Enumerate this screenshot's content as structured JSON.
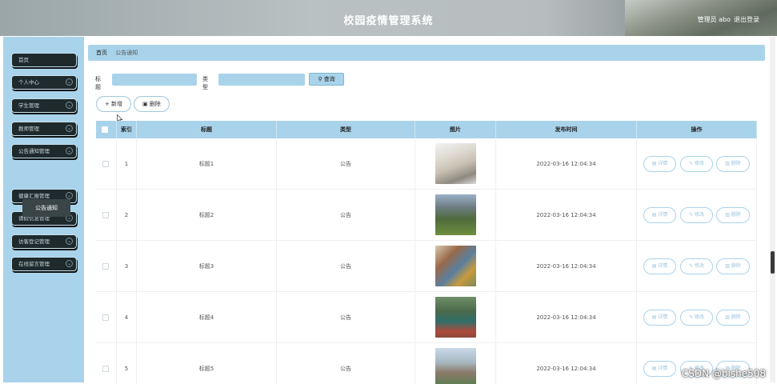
{
  "header": {
    "title": "校园疫情管理系统",
    "user": "管理员 abo",
    "logout": "退出登录"
  },
  "sidebar": {
    "items": [
      {
        "label": "首页",
        "has_chevron": false
      },
      {
        "label": "个人中心",
        "has_chevron": true
      },
      {
        "label": "学生管理",
        "has_chevron": true
      },
      {
        "label": "教师管理",
        "has_chevron": true
      },
      {
        "label": "公告通知管理",
        "has_chevron": true
      },
      {
        "label": "健康汇报管理",
        "has_chevron": true
      },
      {
        "label": "请假信息管理",
        "has_chevron": true
      },
      {
        "label": "访客登记管理",
        "has_chevron": true
      },
      {
        "label": "在线留言管理",
        "has_chevron": true
      }
    ],
    "submenu": {
      "label": "公告通知"
    }
  },
  "breadcrumb": {
    "home": "首页",
    "current": "公告通知"
  },
  "search": {
    "title_label": "标题",
    "type_label": "类型",
    "button": "查询"
  },
  "actions": {
    "add": "新增",
    "delete": "删除"
  },
  "table": {
    "headers": [
      "",
      "索引",
      "标题",
      "类型",
      "图片",
      "发布时间",
      "操作"
    ],
    "rows": [
      {
        "index": "1",
        "title": "标题1",
        "type": "公告",
        "time": "2022-03-16 12:04:34"
      },
      {
        "index": "2",
        "title": "标题2",
        "type": "公告",
        "time": "2022-03-16 12:04:34"
      },
      {
        "index": "3",
        "title": "标题3",
        "type": "公告",
        "time": "2022-03-16 12:04:34"
      },
      {
        "index": "4",
        "title": "标题4",
        "type": "公告",
        "time": "2022-03-16 12:04:34"
      },
      {
        "index": "5",
        "title": "标题5",
        "type": "公告",
        "time": "2022-03-16 12:04:34"
      }
    ],
    "row_actions": {
      "detail": "详情",
      "edit": "修改",
      "delete": "删除"
    }
  },
  "watermark": "CSDN @bishe508",
  "colors": {
    "accent": "#a9d3ea",
    "menu_bg": "#1e2a2c"
  }
}
